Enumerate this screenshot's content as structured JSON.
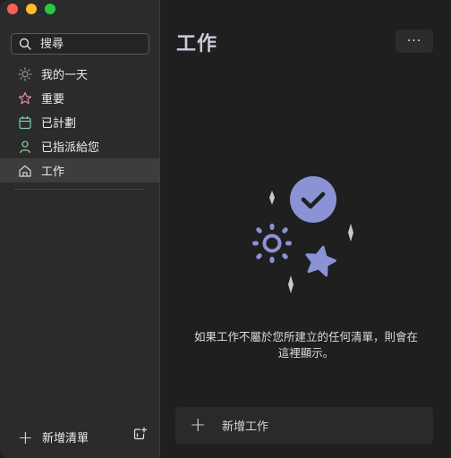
{
  "window": {
    "controls": [
      "close",
      "minimize",
      "maximize"
    ]
  },
  "search": {
    "placeholder": "搜尋",
    "icon": "search-icon"
  },
  "sidebar": {
    "items": [
      {
        "label": "我的一天",
        "icon": "sun-icon",
        "color": "#9a9a9a"
      },
      {
        "label": "重要",
        "icon": "star-icon",
        "color": "#e58ca7"
      },
      {
        "label": "已計劃",
        "icon": "calendar-icon",
        "color": "#7fcdb7"
      },
      {
        "label": "已指派給您",
        "icon": "person-icon",
        "color": "#8fd3a7"
      },
      {
        "label": "工作",
        "icon": "home-icon",
        "color": "#d8d8d8",
        "active": true
      }
    ],
    "new_list_label": "新增清單",
    "new_group_icon": "new-group-icon"
  },
  "main": {
    "title": "工作",
    "title_color": "#c8ccdb",
    "more_label": "···",
    "empty_message": "如果工作不屬於您所建立的任何清單，則會在這裡顯示。",
    "add_task_label": "新增工作",
    "accent": "#8b93d6"
  }
}
